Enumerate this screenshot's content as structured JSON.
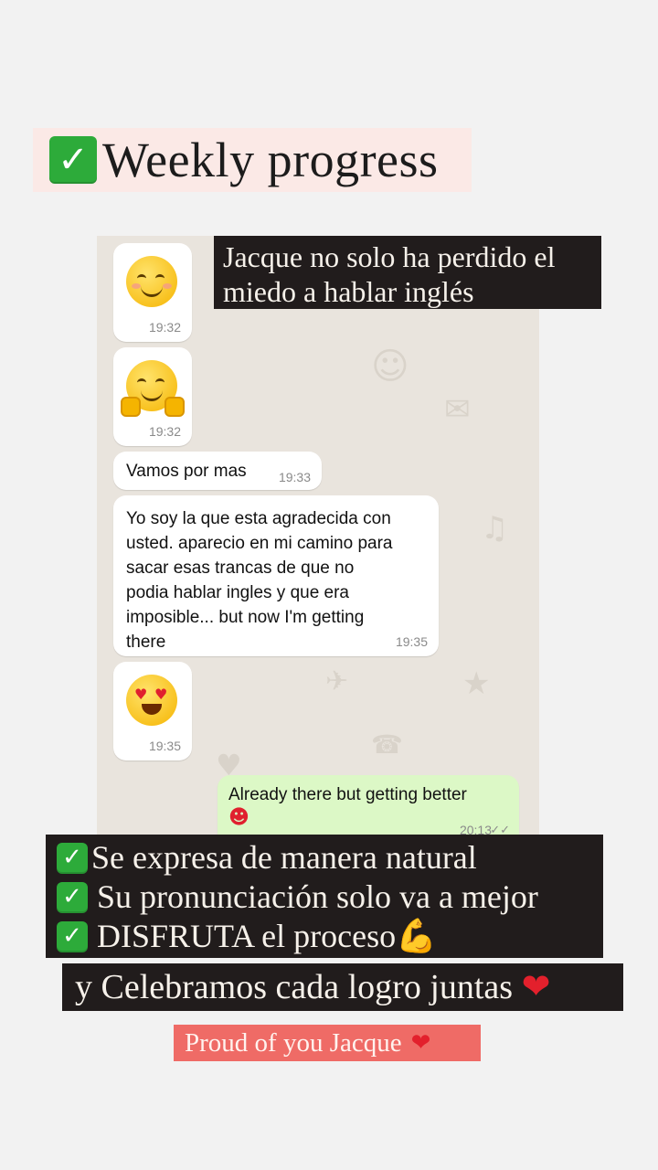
{
  "title": {
    "check_icon": "check-mark-button",
    "text": "Weekly progress"
  },
  "caption_top": {
    "line1": "Jacque no solo ha perdido el",
    "line2": "miedo a hablar inglés"
  },
  "messages": [
    {
      "type": "emoji",
      "emoji": "smiling-face-with-smiling-eyes",
      "time": "19:32"
    },
    {
      "type": "emoji",
      "emoji": "hugging-face",
      "time": "19:32"
    },
    {
      "type": "text",
      "text": "Vamos por mas",
      "time": "19:33"
    },
    {
      "type": "text",
      "text": "Yo soy la que esta agradecida con\nusted. aparecio en mi camino para\nsacar esas trancas  de que no\npodia hablar ingles y que era\nimposible... but now I'm getting\nthere",
      "time": "19:35"
    },
    {
      "type": "emoji",
      "emoji": "smiling-face-with-heart-eyes",
      "time": "19:35"
    },
    {
      "type": "outgoing",
      "text": "Already there but getting better",
      "emoji": "smiling-face-with-heart-eyes",
      "time": "20:13",
      "status": "read"
    }
  ],
  "checklist": [
    {
      "text": "Se expresa de manera natural"
    },
    {
      "text": "Su pronunciación solo va a mejor"
    },
    {
      "text": "DISFRUTA el proceso",
      "emoji": "flexed-biceps"
    }
  ],
  "celebrate": {
    "text": "y Celebramos cada logro juntas",
    "emoji": "red-heart"
  },
  "proud": {
    "text": "Proud of you Jacque",
    "emoji": "red-heart"
  },
  "colors": {
    "background": "#f2f2f2",
    "title_bg": "#fbe9e6",
    "caption_bg": "#211c1c",
    "proud_bg": "#ef6b66",
    "chat_bg": "#e9e4dd",
    "outgoing_bubble": "#dcf8c6",
    "check_green": "#2dab3a"
  }
}
